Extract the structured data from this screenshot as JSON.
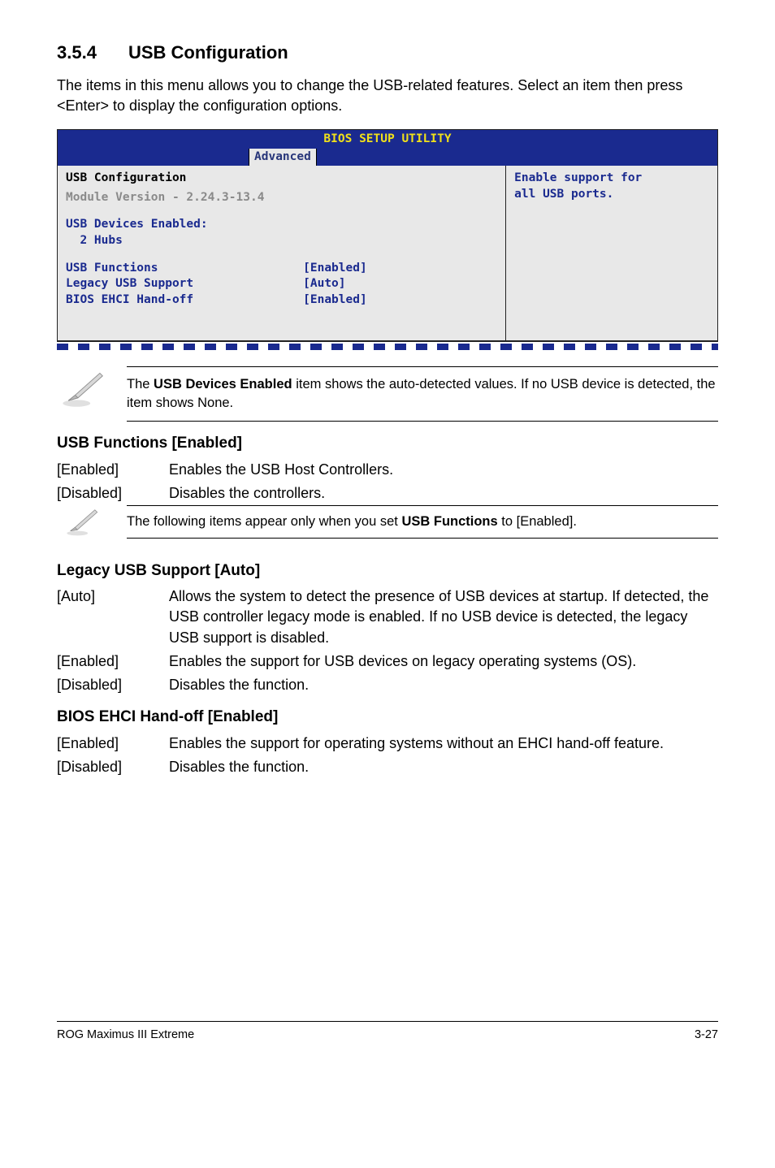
{
  "section": {
    "number": "3.5.4",
    "title": "USB Configuration"
  },
  "intro": "The items in this menu allows you to change the USB-related features. Select an item then press <Enter> to display the configuration options.",
  "bios": {
    "utility_title": "BIOS SETUP UTILITY",
    "tab": "Advanced",
    "heading": "USB Configuration",
    "module": "Module Version - 2.24.3-13.4",
    "devices_line1": "USB Devices Enabled:",
    "devices_line2": "  2 Hubs",
    "rows": [
      {
        "label": "USB Functions",
        "value": "[Enabled]"
      },
      {
        "label": "Legacy USB Support",
        "value": "[Auto]"
      },
      {
        "label": "BIOS EHCI Hand-off",
        "value": "[Enabled]"
      }
    ],
    "help_line1": "Enable support for",
    "help_line2": "all USB ports."
  },
  "note1_a": "The ",
  "note1_b": "USB Devices Enabled",
  "note1_c": " item shows the auto-detected values. If no USB device is detected, the item shows None.",
  "h_usb_functions": "USB Functions [Enabled]",
  "usb_functions": [
    {
      "k": "[Enabled]",
      "v": "Enables the USB Host Controllers."
    },
    {
      "k": "[Disabled]",
      "v": "Disables the controllers."
    }
  ],
  "note2_a": "The following items appear only when you set ",
  "note2_b": "USB Functions",
  "note2_c": " to [Enabled].",
  "h_legacy": "Legacy USB Support [Auto]",
  "legacy": [
    {
      "k": "[Auto]",
      "v": "Allows the system to detect the presence of USB devices at startup. If detected, the USB controller legacy mode is enabled. If no USB device is detected, the legacy USB support is disabled."
    },
    {
      "k": "[Enabled]",
      "v": "Enables the support for USB devices on legacy operating systems (OS)."
    },
    {
      "k": "[Disabled]",
      "v": "Disables the function."
    }
  ],
  "h_ehci": "BIOS EHCI Hand-off [Enabled]",
  "ehci": [
    {
      "k": "[Enabled]",
      "v": "Enables the support for operating systems without an EHCI hand-off feature."
    },
    {
      "k": "[Disabled]",
      "v": "Disables the function."
    }
  ],
  "footer": {
    "left": "ROG Maximus III Extreme",
    "right": "3-27"
  }
}
